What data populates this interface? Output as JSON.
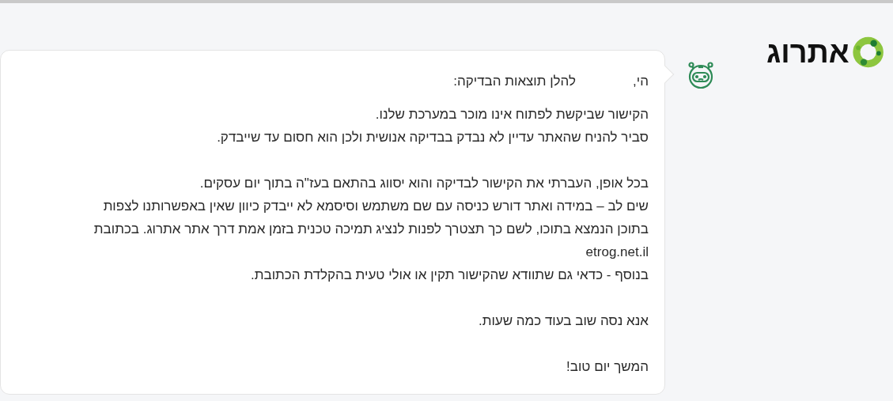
{
  "logo": {
    "text": "אתרוג"
  },
  "message": {
    "greeting": "הי,",
    "intro": "להלן תוצאות הבדיקה:",
    "paragraphs": [
      [
        "הקישור שביקשת לפתוח אינו מוכר במערכת שלנו.",
        "סביר להניח שהאתר עדיין לא נבדק בבדיקה אנושית ולכן הוא חסום עד שייבדק."
      ],
      [
        "בכל אופן, העברתי את הקישור לבדיקה והוא יסווג בהתאם בעז\"ה בתוך יום עסקים.",
        "שים לב – במידה ואתר דורש כניסה עם שם משתמש וסיסמא לא ייבדק כיוון שאין באפשרותנו לצפות בתוכן הנמצא בתוכו, לשם כך תצטרך לפנות לנציג תמיכה טכנית בזמן אמת דרך אתר אתרוג. בכתובת etrog.net.il",
        "בנוסף - כדאי גם שתוודא שהקישור תקין או אולי טעית בהקלדת הכתובת."
      ],
      [
        "אנא נסה שוב בעוד כמה שעות."
      ],
      [
        "המשך יום טוב!"
      ]
    ]
  }
}
